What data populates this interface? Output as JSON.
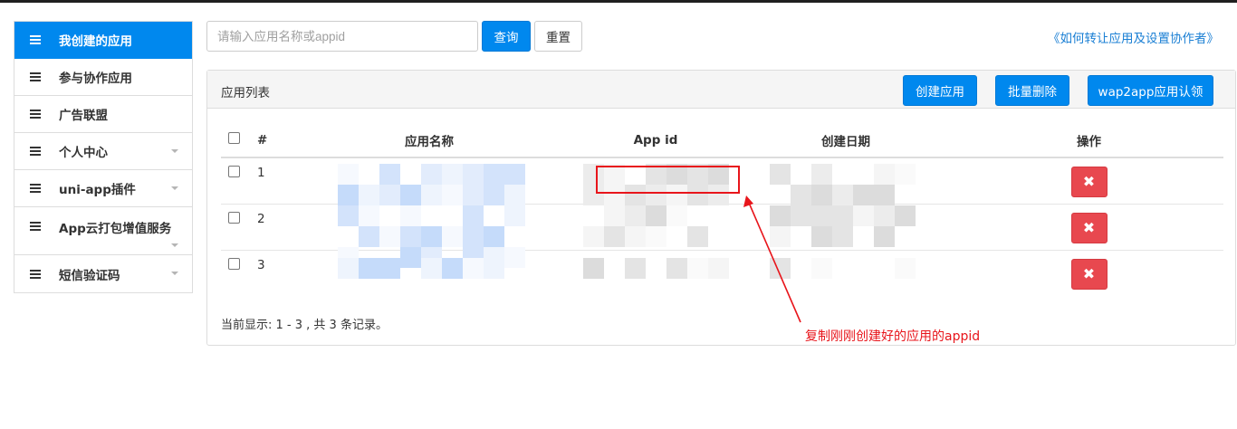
{
  "sidebar": {
    "items": [
      {
        "label": "我创建的应用",
        "active": true,
        "caret": false
      },
      {
        "label": "参与协作应用",
        "active": false,
        "caret": false
      },
      {
        "label": "广告联盟",
        "active": false,
        "caret": false
      },
      {
        "label": "个人中心",
        "active": false,
        "caret": true
      },
      {
        "label": "uni-app插件",
        "active": false,
        "caret": true
      },
      {
        "label": "App云打包增值服务",
        "active": false,
        "caret": true
      },
      {
        "label": "短信验证码",
        "active": false,
        "caret": true
      }
    ]
  },
  "search": {
    "placeholder": "请输入应用名称或appid",
    "value": "",
    "query_label": "查询",
    "reset_label": "重置"
  },
  "help_link": "《如何转让应用及设置协作者》",
  "panel": {
    "title": "应用列表",
    "create_label": "创建应用",
    "batch_delete_label": "批量删除",
    "wap2app_label": "wap2app应用认领"
  },
  "table": {
    "columns": [
      "#",
      "应用名称",
      "App id",
      "创建日期",
      "操作"
    ],
    "rows": [
      {
        "index": "1"
      },
      {
        "index": "2"
      },
      {
        "index": "3"
      }
    ],
    "delete_glyph": "✖"
  },
  "footer_note": "当前显示: 1 - 3 , 共 3 条记录。",
  "annotation": "复制刚刚创建好的应用的appid",
  "colors": {
    "primary": "#0088ee",
    "danger": "#e8484f",
    "annotation_red": "#e8151b",
    "link": "#1a7fd4"
  }
}
